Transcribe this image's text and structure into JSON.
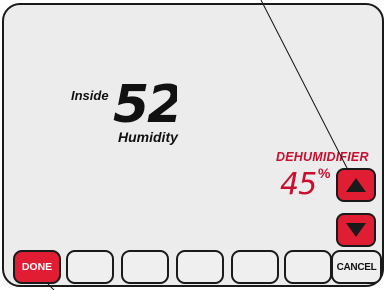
{
  "display": {
    "inside_label": "Inside",
    "humidity_value": "52",
    "humidity_label": "Humidity",
    "mode_label": "DEHUMIDIFIER",
    "setpoint_value": "45",
    "setpoint_unit": "%"
  },
  "buttons": {
    "done_label": "DONE",
    "cancel_label": "CANCEL"
  },
  "icons": {
    "up": "up-arrow-icon",
    "down": "down-arrow-icon"
  },
  "colors": {
    "accent": "#e11d34",
    "text_red": "#c8102e",
    "screen": "#ececec",
    "outline": "#1a1a1a"
  }
}
